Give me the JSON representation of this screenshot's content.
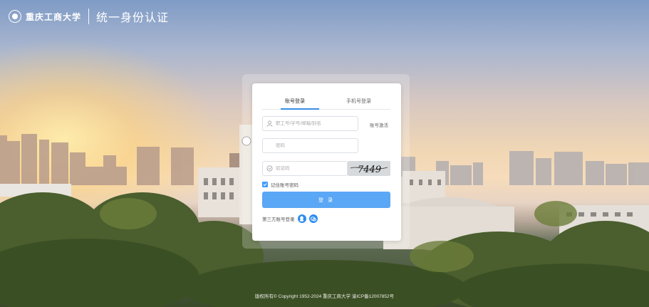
{
  "header": {
    "logo_text": "重庆工商大学",
    "title": "统一身份认证"
  },
  "login": {
    "tabs": [
      {
        "label": "账号登录",
        "active": true
      },
      {
        "label": "手机号登录",
        "active": false
      }
    ],
    "username_placeholder": "职工号/学号/邮箱/别名",
    "forgot_label": "账号激活",
    "password_placeholder": "密码",
    "captcha_placeholder": "验证码",
    "captcha_text": "7449",
    "remember_label": "记住账号密码",
    "remember_checked": true,
    "login_button": "登 录",
    "third_party_label": "第三方账号登录",
    "third_party_icons": [
      "qq-icon",
      "wechat-work-icon"
    ],
    "accent_color": "#409eff"
  },
  "footer": {
    "copyright": "版权所有© Copyright 1952-2024 重庆工商大学 渝ICP备12007852号"
  }
}
